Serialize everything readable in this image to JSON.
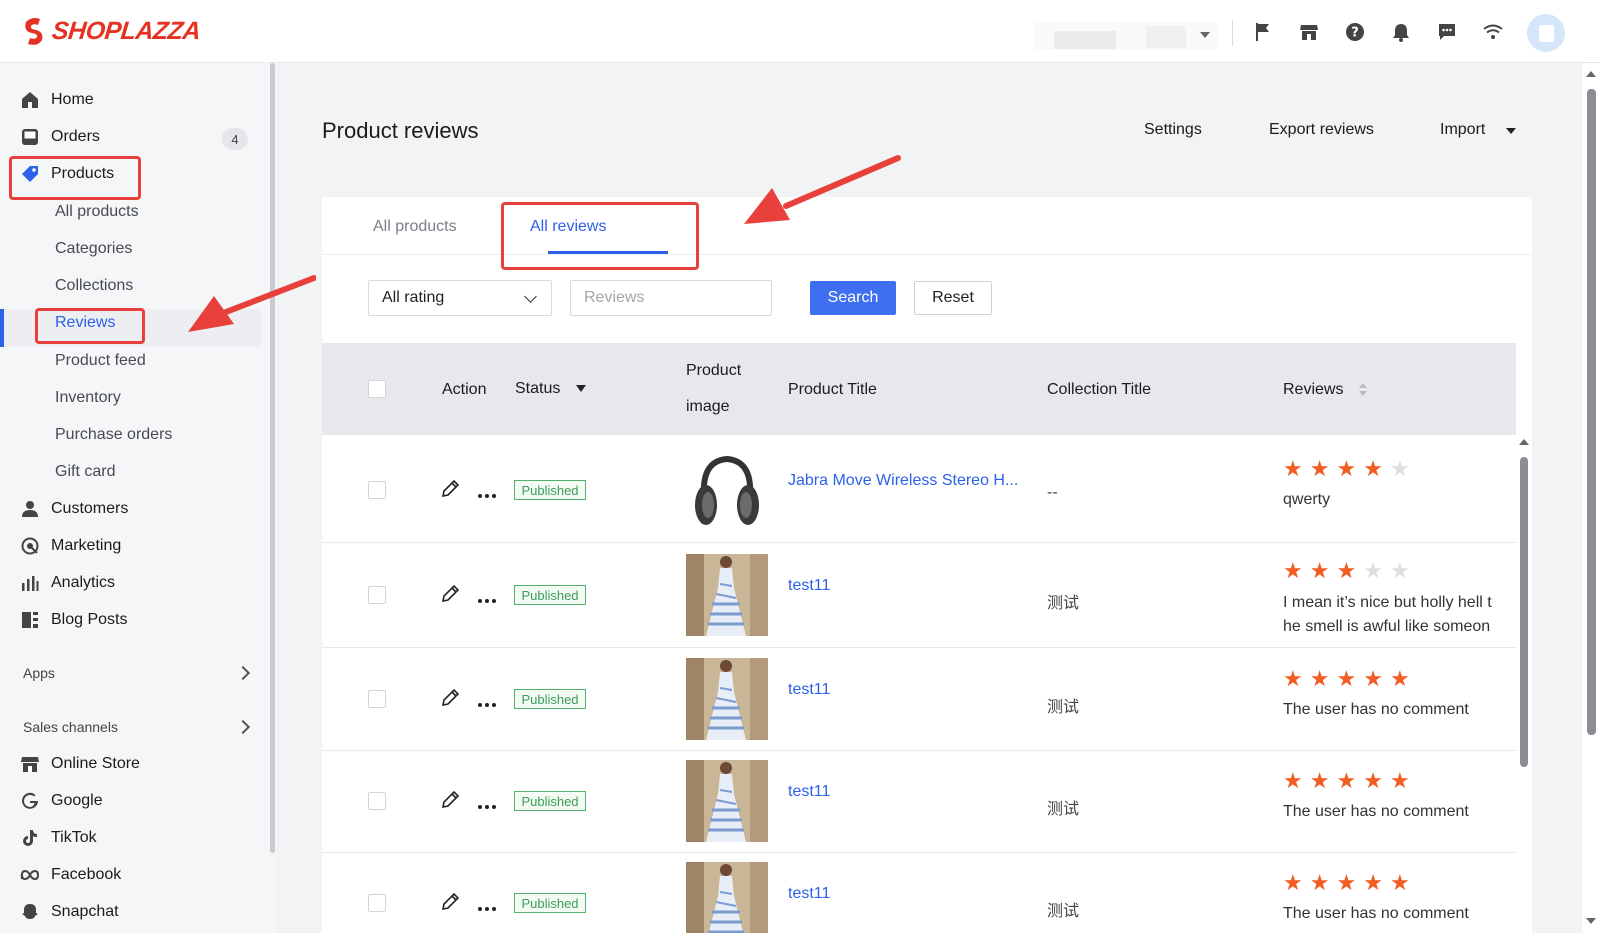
{
  "app": {
    "logo_text": "SHOPLAZZA"
  },
  "sidebar": {
    "items": [
      {
        "label": "Home",
        "icon": "home-icon"
      },
      {
        "label": "Orders",
        "icon": "inbox-icon",
        "badge": "4"
      },
      {
        "label": "Products",
        "icon": "tag-icon"
      }
    ],
    "product_sub": [
      "All products",
      "Categories",
      "Collections",
      "Reviews",
      "Product feed",
      "Inventory",
      "Purchase orders",
      "Gift card"
    ],
    "lower_items": [
      {
        "label": "Customers",
        "icon": "person-icon"
      },
      {
        "label": "Marketing",
        "icon": "target-icon"
      },
      {
        "label": "Analytics",
        "icon": "bar-chart-icon"
      },
      {
        "label": "Blog Posts",
        "icon": "blog-icon"
      }
    ],
    "apps_label": "Apps",
    "sales_channels_label": "Sales channels",
    "channels": [
      {
        "label": "Online Store",
        "icon": "store-icon"
      },
      {
        "label": "Google",
        "icon": "google-icon"
      },
      {
        "label": "TikTok",
        "icon": "tiktok-icon"
      },
      {
        "label": "Facebook",
        "icon": "meta-icon"
      },
      {
        "label": "Snapchat",
        "icon": "snapchat-icon"
      }
    ]
  },
  "header": {
    "title": "Product reviews",
    "settings": "Settings",
    "export": "Export reviews",
    "import": "Import"
  },
  "tabs": [
    {
      "label": "All products"
    },
    {
      "label": "All reviews"
    }
  ],
  "filters": {
    "rating": "All rating",
    "search_placeholder": "Reviews",
    "search_button": "Search",
    "reset_button": "Reset"
  },
  "table": {
    "columns": {
      "action": "Action",
      "status": "Status",
      "image_line1": "Product",
      "image_line2": "image",
      "title": "Product Title",
      "collection": "Collection Title",
      "reviews": "Reviews"
    },
    "rows": [
      {
        "status": "Published",
        "image": "headphones",
        "title": "Jabra Move Wireless Stereo H...",
        "collection": "--",
        "rating": 4,
        "review": "qwerty"
      },
      {
        "status": "Published",
        "image": "dress",
        "title": "test11",
        "collection": "测试",
        "rating": 3,
        "review": "I mean it’s nice but holly hell the smell is awful like someone ..."
      },
      {
        "status": "Published",
        "image": "dress",
        "title": "test11",
        "collection": "测试",
        "rating": 5,
        "review": "The user has no comment"
      },
      {
        "status": "Published",
        "image": "dress",
        "title": "test11",
        "collection": "测试",
        "rating": 5,
        "review": "The user has no comment"
      },
      {
        "status": "Published",
        "image": "dress",
        "title": "test11",
        "collection": "测试",
        "rating": 5,
        "review": "The user has no comment"
      }
    ]
  },
  "colors": {
    "accent": "#2c61e9",
    "star": "#f15d22",
    "annotation": "#e8403a",
    "published": "#3c9e55"
  }
}
